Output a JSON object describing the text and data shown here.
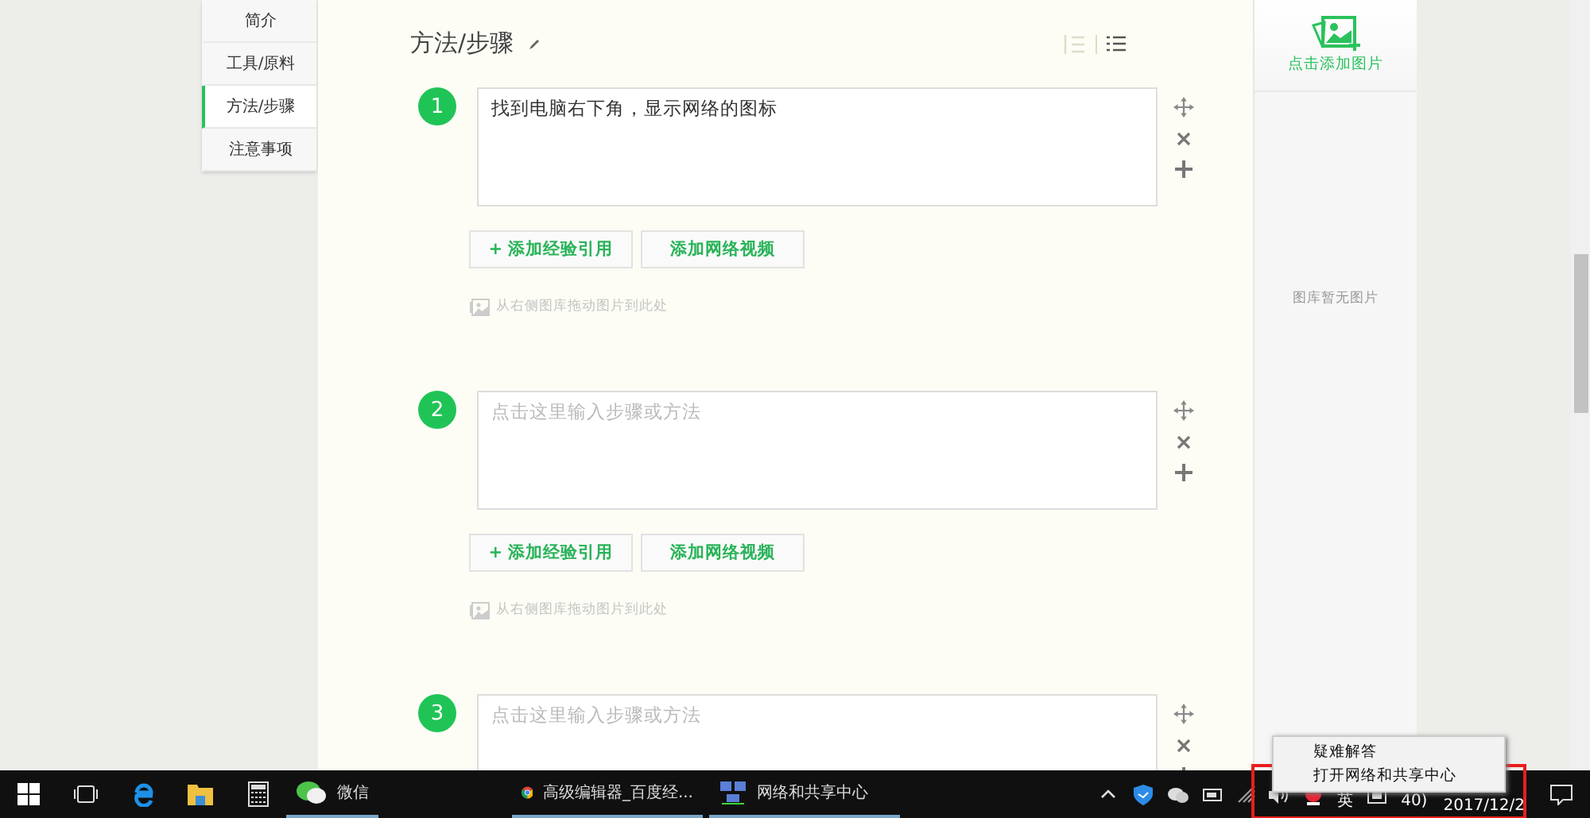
{
  "nav": [
    {
      "label": "简介",
      "selected": false
    },
    {
      "label": "工具/原料",
      "selected": false
    },
    {
      "label": "方法/步骤",
      "selected": true
    },
    {
      "label": "注意事项",
      "selected": false
    }
  ],
  "section": {
    "title": "方法/步骤"
  },
  "steps": [
    {
      "number": "1",
      "value": "找到电脑右下角，显示网络的图标",
      "buttons": [
        "+ 添加经验引用",
        "添加网络视频"
      ],
      "hint": "从右侧图库拖动图片到此处"
    },
    {
      "number": "2",
      "placeholder": "点击这里输入步骤或方法",
      "buttons": [
        "+ 添加经验引用",
        "添加网络视频"
      ],
      "hint": "从右侧图库拖动图片到此处"
    },
    {
      "number": "3",
      "placeholder": "点击这里输入步骤或方法"
    }
  ],
  "gallery": {
    "add_label": "点击添加图片",
    "empty_text": "图库暂无图片"
  },
  "taskbar": {
    "apps": [
      {
        "kind": "wechat",
        "label": "微信"
      },
      {
        "kind": "chrome",
        "label": "高级编辑器_百度经..."
      },
      {
        "kind": "network",
        "label": "网络和共享中心"
      }
    ],
    "tray": {
      "ime": "英",
      "clock_partial": "40)",
      "date": "2017/12/2"
    }
  },
  "context_menu": {
    "items": [
      "疑难解答",
      "打开网络和共享中心"
    ]
  }
}
